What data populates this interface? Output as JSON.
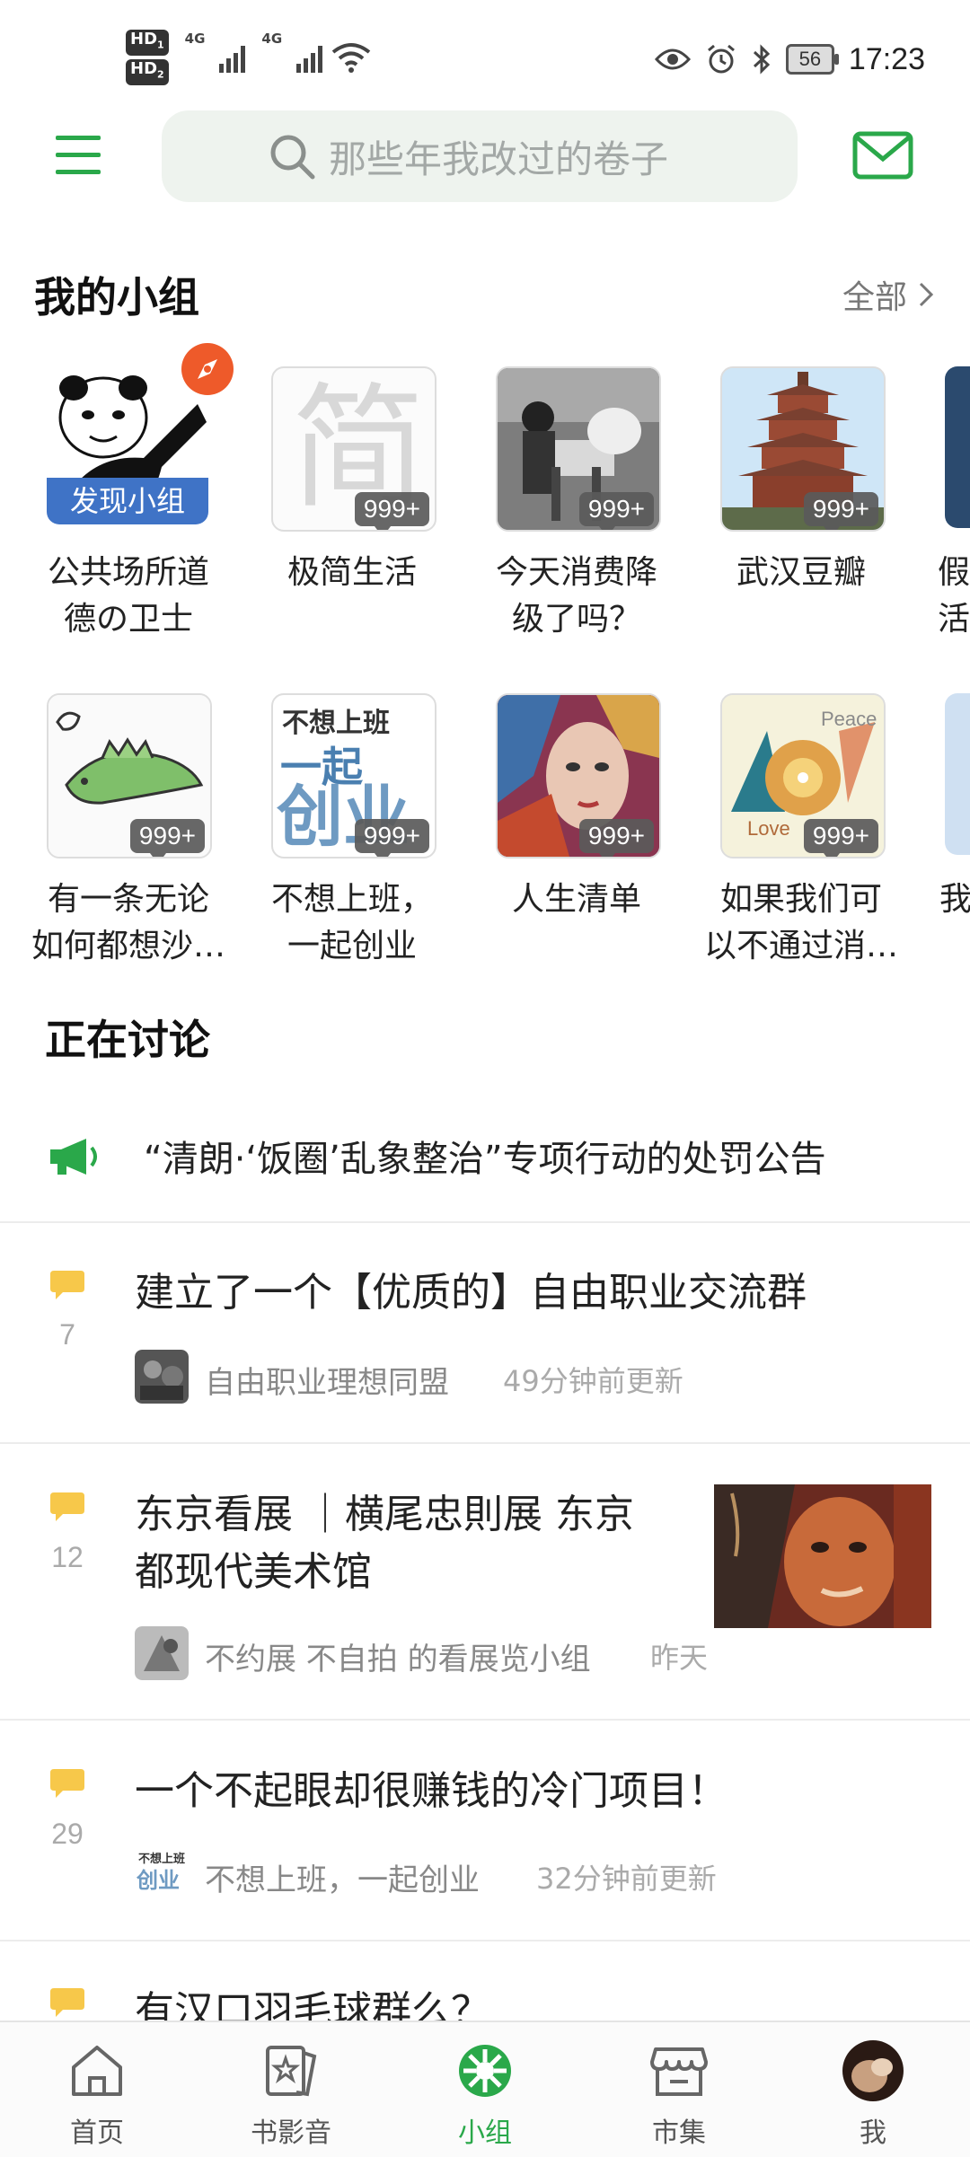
{
  "status_bar": {
    "hd1": "HD",
    "hd1_sub": "1",
    "hd2": "HD",
    "hd2_sub": "2",
    "net1": "4G",
    "net2": "4G",
    "battery": "56",
    "time": "17:23"
  },
  "header": {
    "search_placeholder": "那些年我改过的卷子"
  },
  "my_groups": {
    "title": "我的小组",
    "all_label": "全部",
    "discover_label": "发现小组",
    "groups": [
      {
        "name_line1": "公共场所道",
        "name_line2": "德の卫士",
        "badge": ""
      },
      {
        "name_line1": "极简生活",
        "name_line2": "",
        "badge": "999+"
      },
      {
        "name_line1": "今天消费降",
        "name_line2": "级了吗？",
        "badge": "999+"
      },
      {
        "name_line1": "武汉豆瓣",
        "name_line2": "",
        "badge": "999+"
      },
      {
        "name_line1": "假",
        "name_line2": "活在",
        "badge": ""
      },
      {
        "name_line1": "有一条无论",
        "name_line2": "如何都想沙…",
        "badge": "999+"
      },
      {
        "name_line1": "不想上班，",
        "name_line2": "一起创业",
        "badge": "999+"
      },
      {
        "name_line1": "人生清单",
        "name_line2": "",
        "badge": "999+"
      },
      {
        "name_line1": "如果我们可",
        "name_line2": "以不通过消…",
        "badge": "999+"
      },
      {
        "name_line1": "我",
        "name_line2": "",
        "badge": ""
      }
    ],
    "tile_texts": {
      "jian_char": "简",
      "cy_top": "不想上班",
      "cy_mid": "一起",
      "cy_big": "创业",
      "peace": "Peace",
      "love": "Love"
    }
  },
  "discussion": {
    "title": "正在讨论",
    "notice": "“清朗·‘饭圈’乱象整治”专项行动的处罚公告",
    "posts": [
      {
        "count": "7",
        "title_line1": "建立了一个【优质的】自由职业交流群",
        "title_line2": "",
        "group": "自由职业理想同盟",
        "time": "49分钟前更新"
      },
      {
        "count": "12",
        "title_line1": "东京看展 ｜横尾忠則展 东京",
        "title_line2": "都现代美术馆",
        "group": "不约展 不自拍 的看展览小组",
        "time": "昨天"
      },
      {
        "count": "29",
        "title_line1": "一个不起眼却很赚钱的冷门项目！",
        "title_line2": "",
        "group": "不想上班，一起创业",
        "time": "32分钟前更新"
      },
      {
        "count": "",
        "title_line1": "有汉口羽毛球群么？",
        "title_line2": "",
        "group": "",
        "time": ""
      }
    ]
  },
  "bottom_nav": {
    "items": [
      {
        "label": "首页"
      },
      {
        "label": "书影音"
      },
      {
        "label": "小组"
      },
      {
        "label": "市集"
      },
      {
        "label": "我"
      }
    ]
  },
  "colors": {
    "brand_green": "#2aa84a",
    "bubble_yellow": "#f7c84a",
    "discover_blue": "#3f73c6",
    "compass_orange": "#ee5a2a"
  }
}
